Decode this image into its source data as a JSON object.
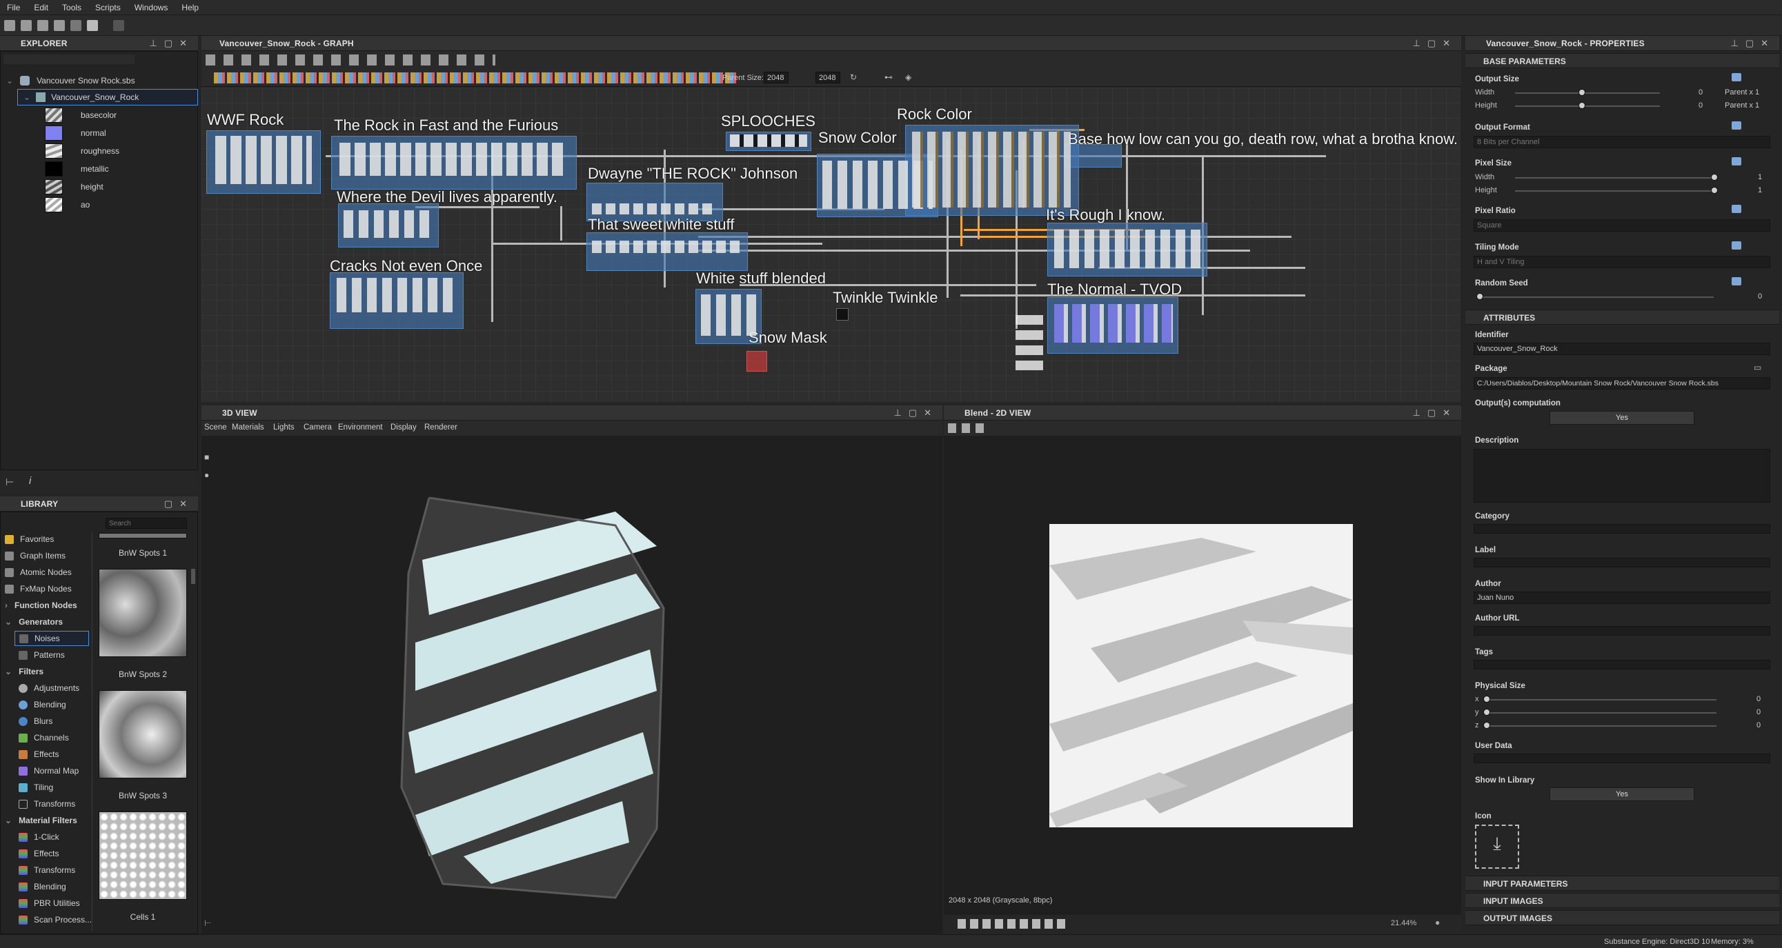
{
  "menu": [
    "File",
    "Edit",
    "Tools",
    "Scripts",
    "Windows",
    "Help"
  ],
  "explorer": {
    "title": "EXPLORER",
    "package": "Vancouver Snow Rock.sbs",
    "graph": "Vancouver_Snow_Rock",
    "outputs": [
      "basecolor",
      "normal",
      "roughness",
      "metallic",
      "height",
      "ao"
    ]
  },
  "graph": {
    "title": "Vancouver_Snow_Rock - GRAPH",
    "parent_size_label": "Parent Size:",
    "size_w": "2048",
    "size_h": "2048",
    "frames": [
      "WWF Rock",
      "The Rock in Fast and the Furious",
      "Where the Devil lives apparently.",
      "Cracks Not even Once",
      "Dwayne \"THE ROCK\" Johnson",
      "That sweet white stuff",
      "SPLOOCHES",
      "Snow Color",
      "Rock Color",
      "Base how low can you go, death row, what a brotha know.",
      "It's Rough I know.",
      "White stuff blended",
      "Twinkle Twinkle",
      "Snow Mask",
      "The Normal - TVOD"
    ]
  },
  "view3d": {
    "title": "3D VIEW",
    "menu": [
      "Scene",
      "Materials",
      "Lights",
      "Camera",
      "Environment",
      "Display",
      "Renderer"
    ]
  },
  "view2d": {
    "title": "Blend - 2D VIEW",
    "info": "2048 x 2048 (Grayscale, 8bpc)",
    "zoom": "21.44%"
  },
  "library": {
    "title": "LIBRARY",
    "search_placeholder": "Search",
    "items": [
      "Favorites",
      "Graph Items",
      "Atomic Nodes",
      "FxMap Nodes",
      "Function Nodes",
      "Generators",
      "Noises",
      "Patterns",
      "Filters",
      "Adjustments",
      "Blending",
      "Blurs",
      "Channels",
      "Effects",
      "Normal Map",
      "Tiling",
      "Transforms",
      "Material Filters",
      "1-Click",
      "Effects",
      "Transforms",
      "Blending",
      "PBR Utilities",
      "Scan Process..."
    ],
    "thumbs": [
      "BnW Spots 1",
      "BnW Spots 2",
      "BnW Spots 3",
      "Cells 1"
    ]
  },
  "properties": {
    "title": "Vancouver_Snow_Rock - PROPERTIES",
    "base_parameters": "BASE PARAMETERS",
    "output_size": "Output Size",
    "width": "Width",
    "height": "Height",
    "output_size_w_val": "0",
    "output_size_h_val": "0",
    "parent_x1": "Parent x 1",
    "output_format": "Output Format",
    "output_format_val": "8 Bits per Channel",
    "pixel_size": "Pixel Size",
    "pixel_size_w_val": "1",
    "pixel_size_h_val": "1",
    "pixel_ratio": "Pixel Ratio",
    "pixel_ratio_val": "Square",
    "tiling_mode": "Tiling Mode",
    "tiling_mode_val": "H and V Tiling",
    "random_seed": "Random Seed",
    "random_seed_val": "0",
    "attributes": "ATTRIBUTES",
    "identifier": "Identifier",
    "identifier_val": "Vancouver_Snow_Rock",
    "package": "Package",
    "package_val": "C:/Users/Diablos/Desktop/Mountain Snow Rock/Vancouver Snow Rock.sbs",
    "output_comp": "Output(s) computation",
    "yes": "Yes",
    "description": "Description",
    "category": "Category",
    "label": "Label",
    "author": "Author",
    "author_val": "Juan Nuno",
    "author_url": "Author URL",
    "tags": "Tags",
    "physical_size": "Physical Size",
    "px": "x",
    "py": "y",
    "pz": "z",
    "pval": "0",
    "user_data": "User Data",
    "show_in_library": "Show In Library",
    "icon": "Icon",
    "input_parameters": "INPUT PARAMETERS",
    "input_images": "INPUT IMAGES",
    "output_images": "OUTPUT IMAGES"
  },
  "status": {
    "engine": "Substance Engine: Direct3D 10",
    "memory": "Memory: 3%"
  }
}
